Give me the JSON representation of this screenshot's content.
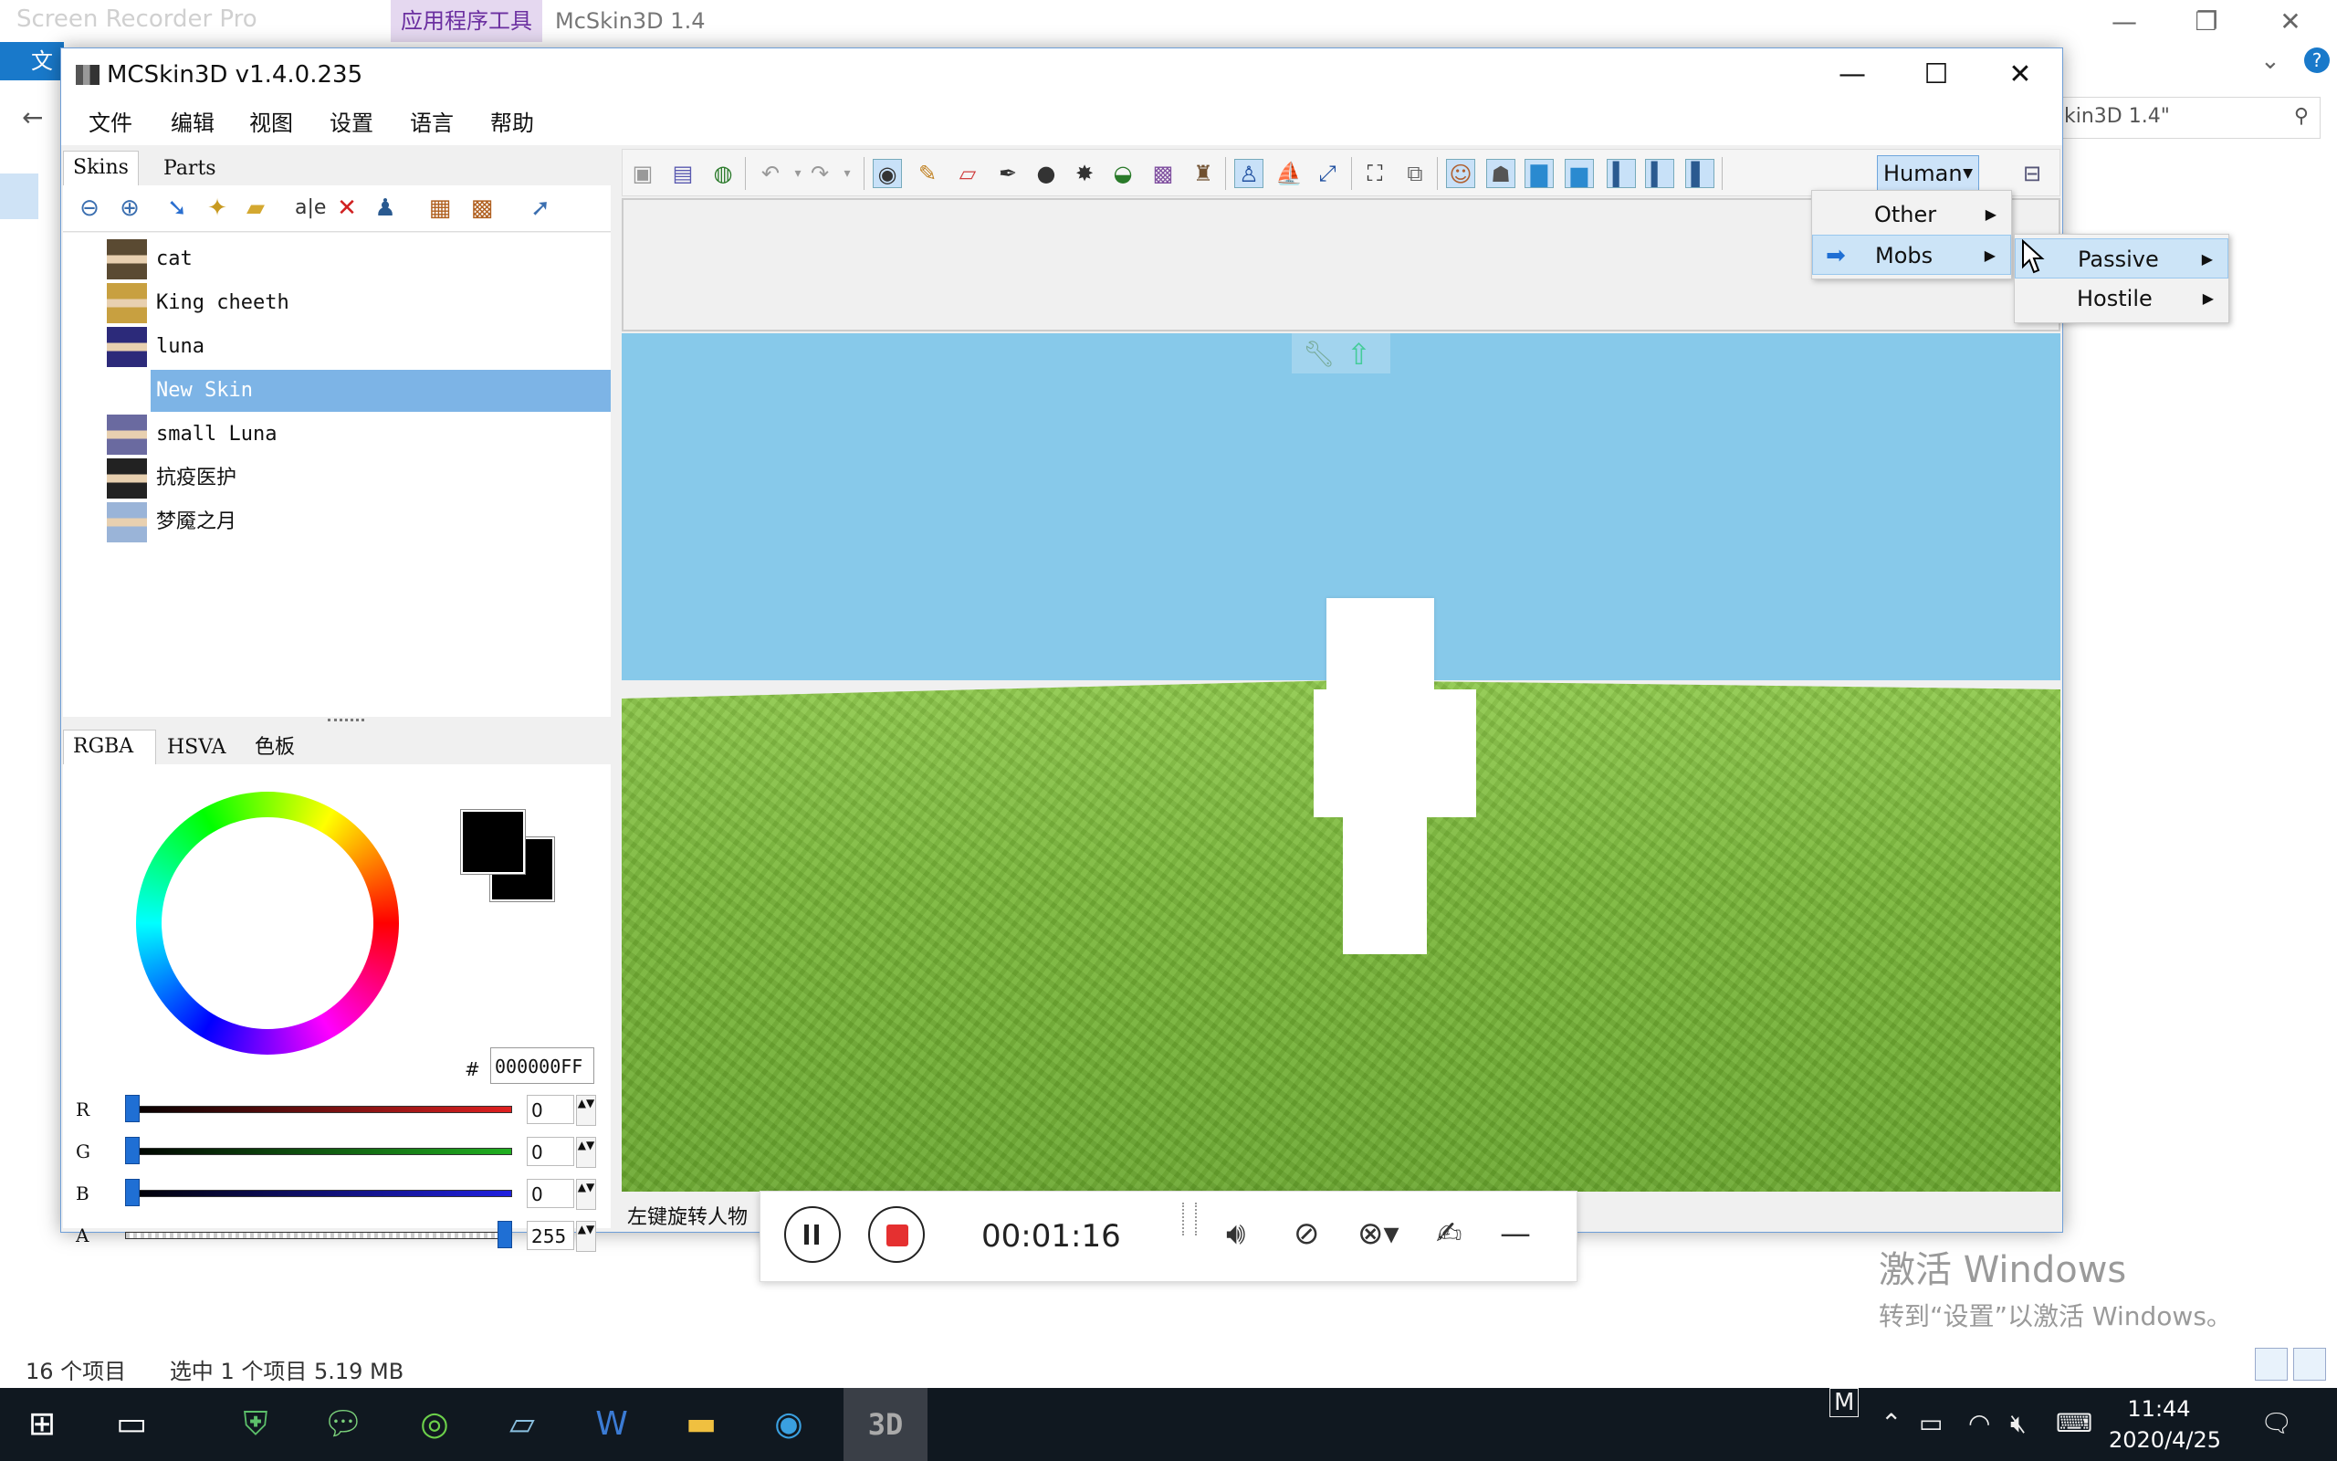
{
  "explorer": {
    "ribbon_tab": "应用程序工具",
    "title": "McSkin3D 1.4",
    "file_tab": "文件",
    "search_text": "kin3D 1.4\"",
    "status_count": "16 个项目",
    "status_selected": "选中 1 个项目  5.19 MB"
  },
  "recorder_overlay": "Screen Recorder Pro",
  "watermark": {
    "line1": "激活 Windows",
    "line2": "转到“设置”以激活 Windows。"
  },
  "mc_window": {
    "title": "MCSkin3D v1.4.0.235",
    "menu": [
      "文件",
      "编辑",
      "视图",
      "设置",
      "语言",
      "帮助"
    ],
    "skin_tabs": [
      "Skins",
      "Parts"
    ],
    "skins": [
      {
        "name": "cat",
        "thumb_color": "#5a4a32"
      },
      {
        "name": "King cheeth",
        "thumb_color": "#c8a040"
      },
      {
        "name": "luna",
        "thumb_color": "#2c2a7a"
      },
      {
        "name": "New Skin",
        "thumb_color": "#ffffff",
        "selected": true
      },
      {
        "name": "small Luna",
        "thumb_color": "#6a6aa0"
      },
      {
        "name": "抗疫医护",
        "thumb_color": "#222222"
      },
      {
        "name": "梦魇之月",
        "thumb_color": "#9ab4d8"
      }
    ],
    "color_tabs": [
      "RGBA",
      "HSVA",
      "色板"
    ],
    "hex_label": "#",
    "hex_value": "000000FF",
    "sliders": [
      {
        "label": "R",
        "value": "0",
        "color": "#e02020",
        "level": 0
      },
      {
        "label": "G",
        "value": "0",
        "color": "#20b020",
        "level": 0
      },
      {
        "label": "B",
        "value": "0",
        "color": "#2020e0",
        "level": 0
      },
      {
        "label": "A",
        "value": "255",
        "color": "#000000",
        "level": 1
      }
    ],
    "model_dropdown": "Human",
    "status_text": "左键旋转人物",
    "menu_level1": [
      {
        "label": "Other"
      },
      {
        "label": "Mobs",
        "highlighted": true
      }
    ],
    "menu_level2": [
      {
        "label": "Passive",
        "highlighted": true
      },
      {
        "label": "Hostile"
      }
    ]
  },
  "recorder": {
    "time": "00:01:16"
  },
  "taskbar": {
    "app_3d": "3D",
    "time": "11:44",
    "date": "2020/4/25",
    "ime": "M"
  }
}
